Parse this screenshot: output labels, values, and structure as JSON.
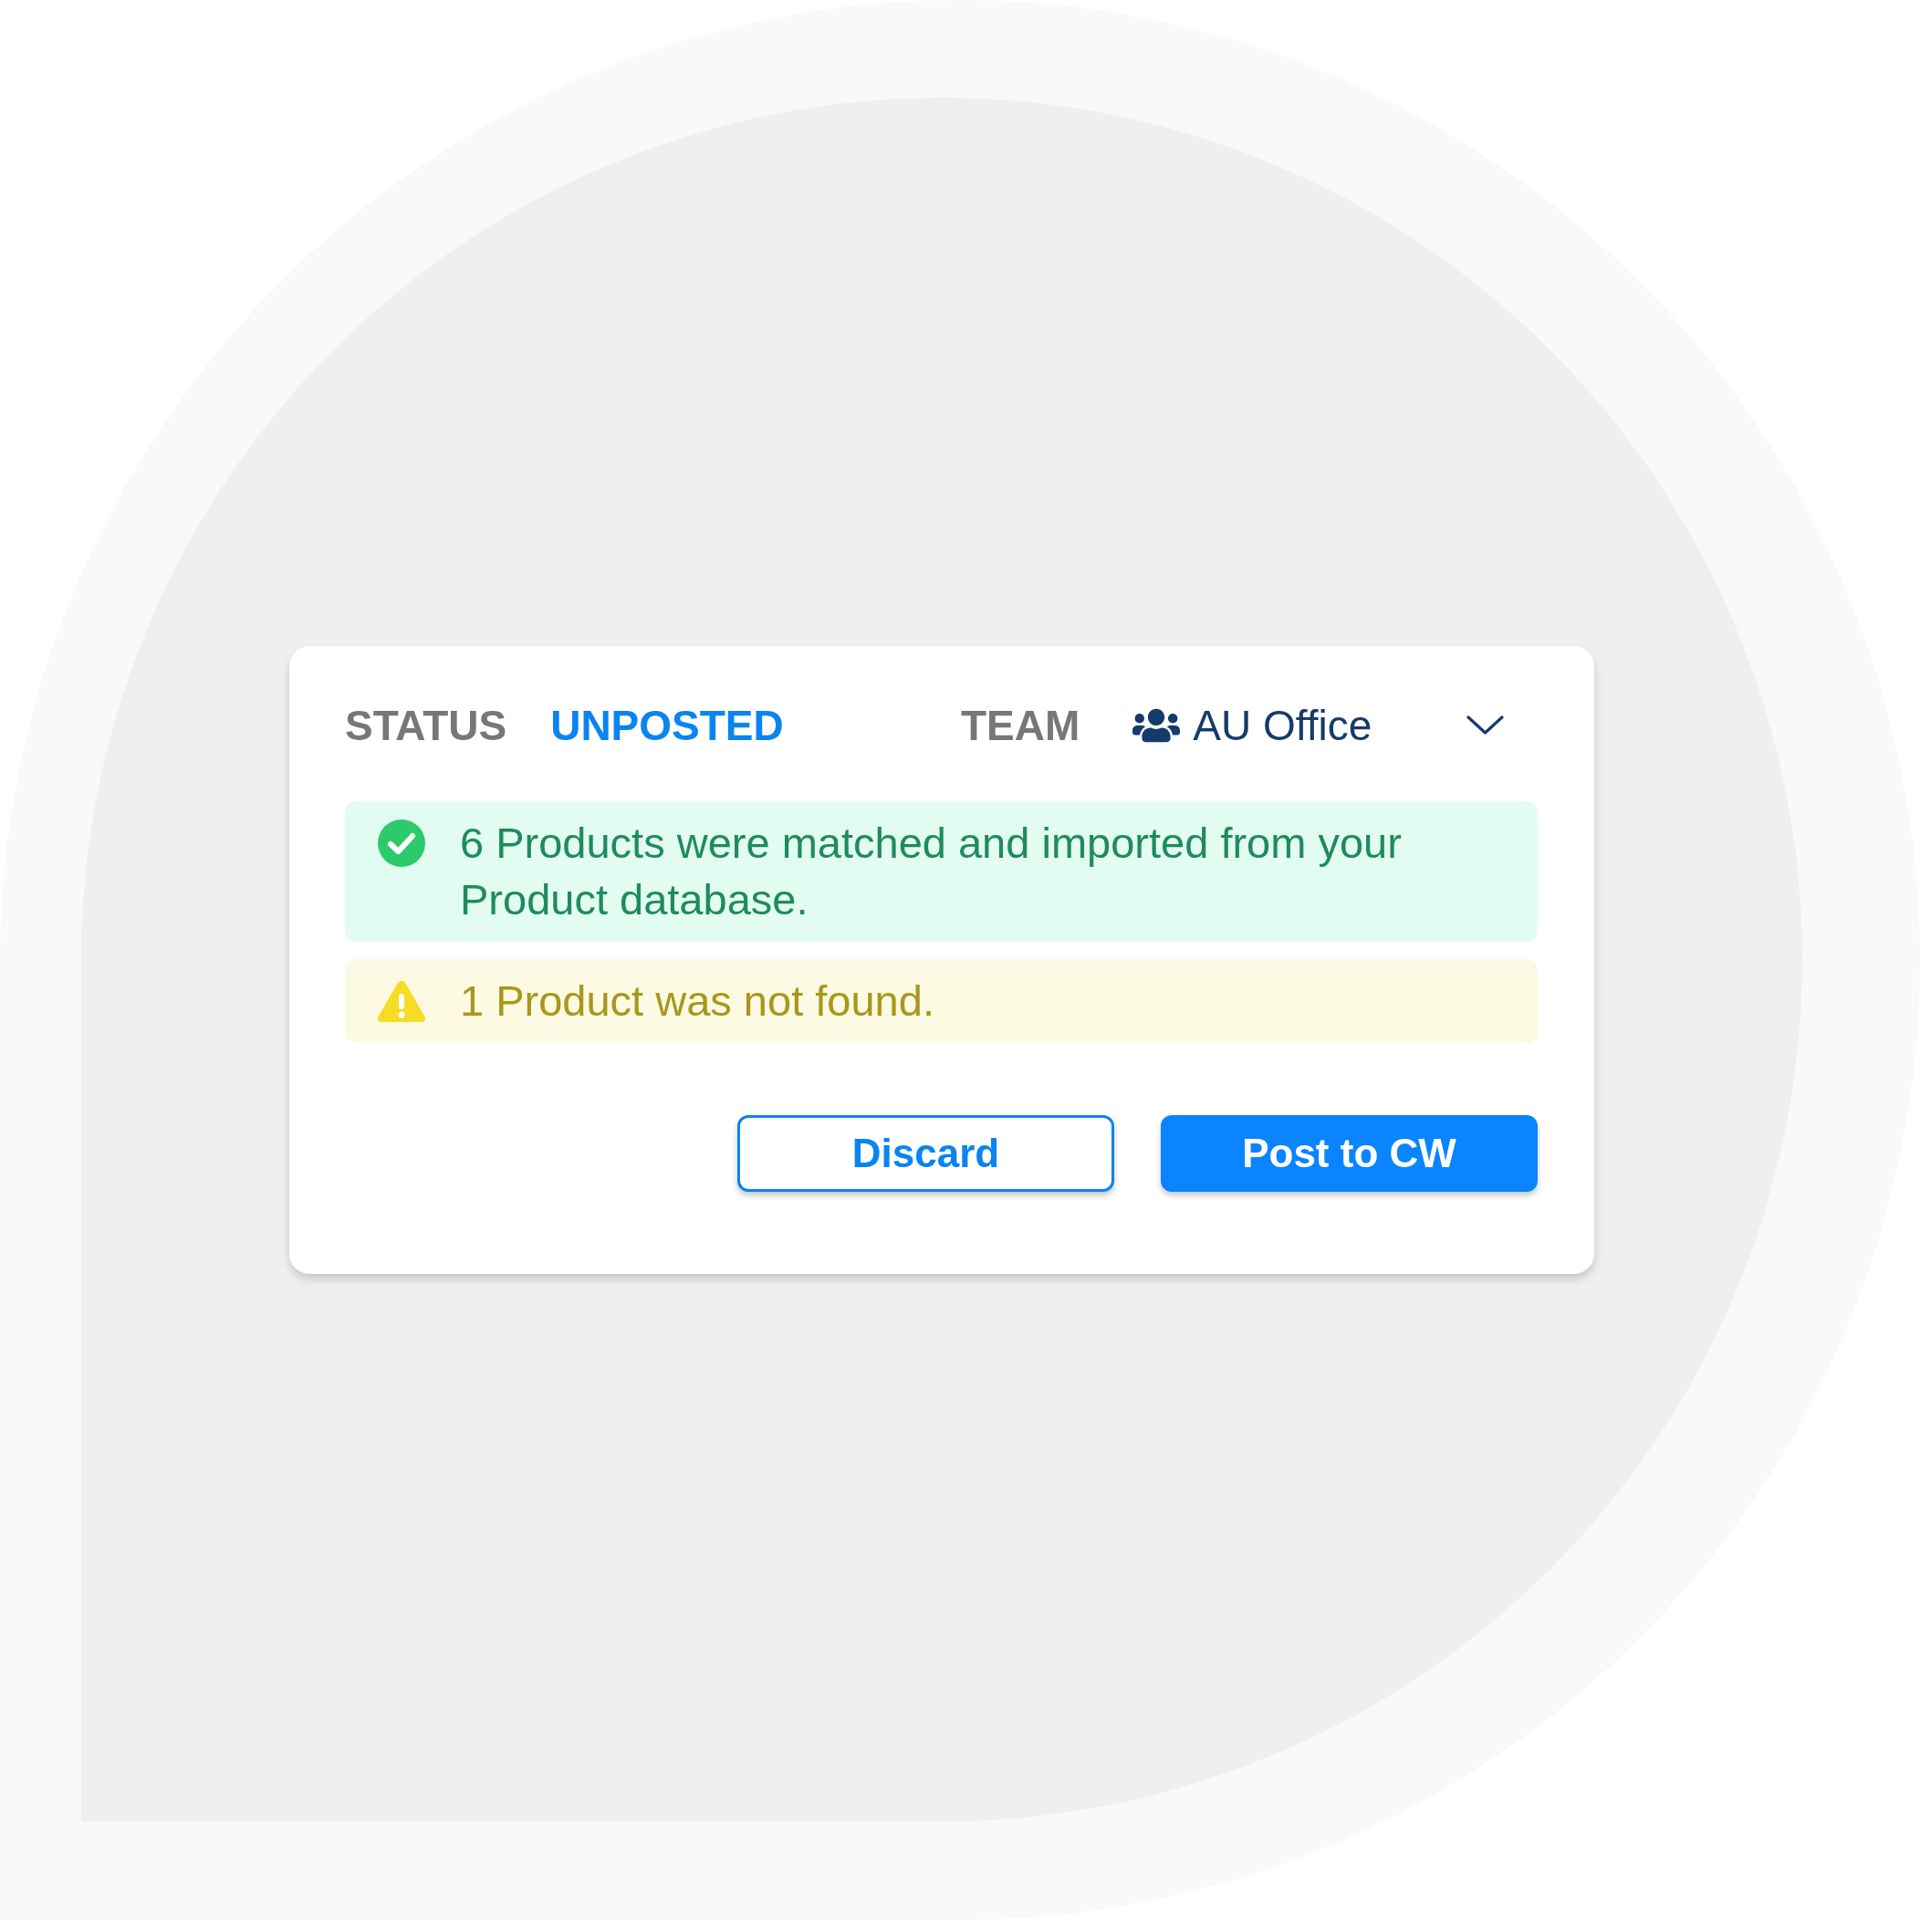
{
  "status": {
    "label": "STATUS",
    "value": "UNPOSTED"
  },
  "team": {
    "label": "TEAM",
    "value": "AU Office"
  },
  "messages": [
    {
      "kind": "success",
      "text": "6 Products were matched and imported from your Product database."
    },
    {
      "kind": "warning",
      "text": "1 Product was not found."
    }
  ],
  "buttons": [
    {
      "kind": "secondary",
      "label": "Discard"
    },
    {
      "kind": "primary",
      "label": "Post to CW"
    }
  ]
}
